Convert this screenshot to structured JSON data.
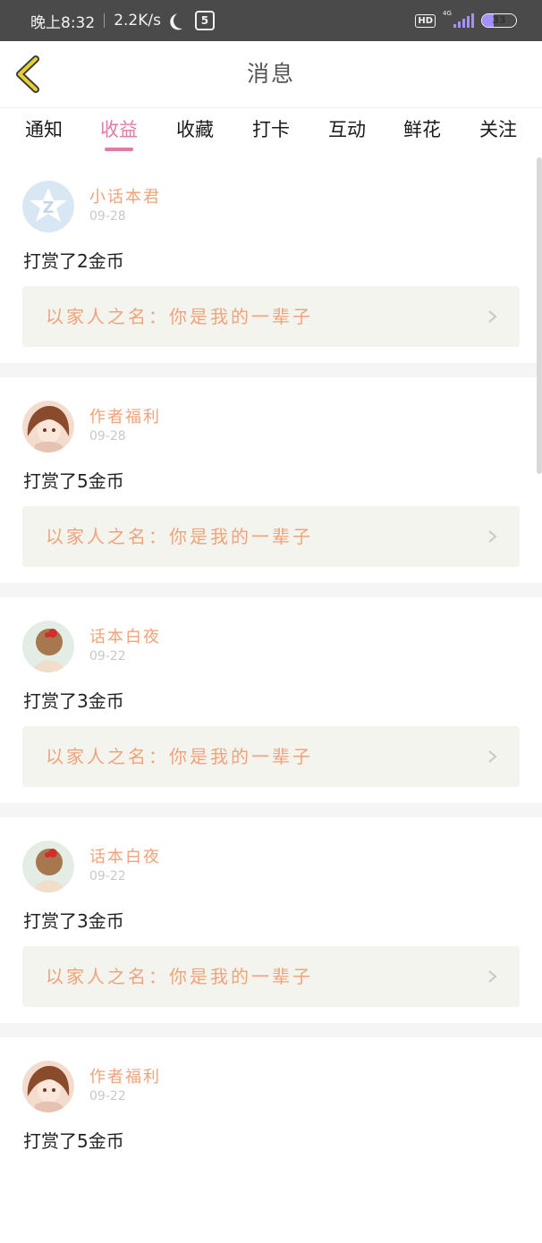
{
  "status_bar": {
    "time": "晚上8:32",
    "speed": "2.2K/s",
    "app_icon": "5",
    "hd": "HD",
    "network": "4G",
    "battery": "33",
    "battery_level": 0.33,
    "signal_color": "#a690ff"
  },
  "header": {
    "title": "消息",
    "back_icon": "chevron-left-icon",
    "back_color": "#e8cf33"
  },
  "tabs": [
    "通知",
    "收益",
    "收藏",
    "打卡",
    "互动",
    "鲜花",
    "关注"
  ],
  "active_tab": "收益",
  "accent": "#e07aa6",
  "messages": [
    {
      "user": "小话本君",
      "date": "09-28",
      "text": "打赏了2金币",
      "book": "以家人之名：你是我的一辈子",
      "avatar": "logo-avatar"
    },
    {
      "user": "作者福利",
      "date": "09-28",
      "text": "打赏了5金币",
      "book": "以家人之名：你是我的一辈子",
      "avatar": "anime-girl-avatar"
    },
    {
      "user": "话本白夜",
      "date": "09-22",
      "text": "打赏了3金币",
      "book": "以家人之名：你是我的一辈子",
      "avatar": "photo-avatar"
    },
    {
      "user": "话本白夜",
      "date": "09-22",
      "text": "打赏了3金币",
      "book": "以家人之名：你是我的一辈子",
      "avatar": "photo-avatar"
    },
    {
      "user": "作者福利",
      "date": "09-22",
      "text": "打赏了5金币",
      "book": "",
      "avatar": "anime-girl-avatar"
    }
  ]
}
